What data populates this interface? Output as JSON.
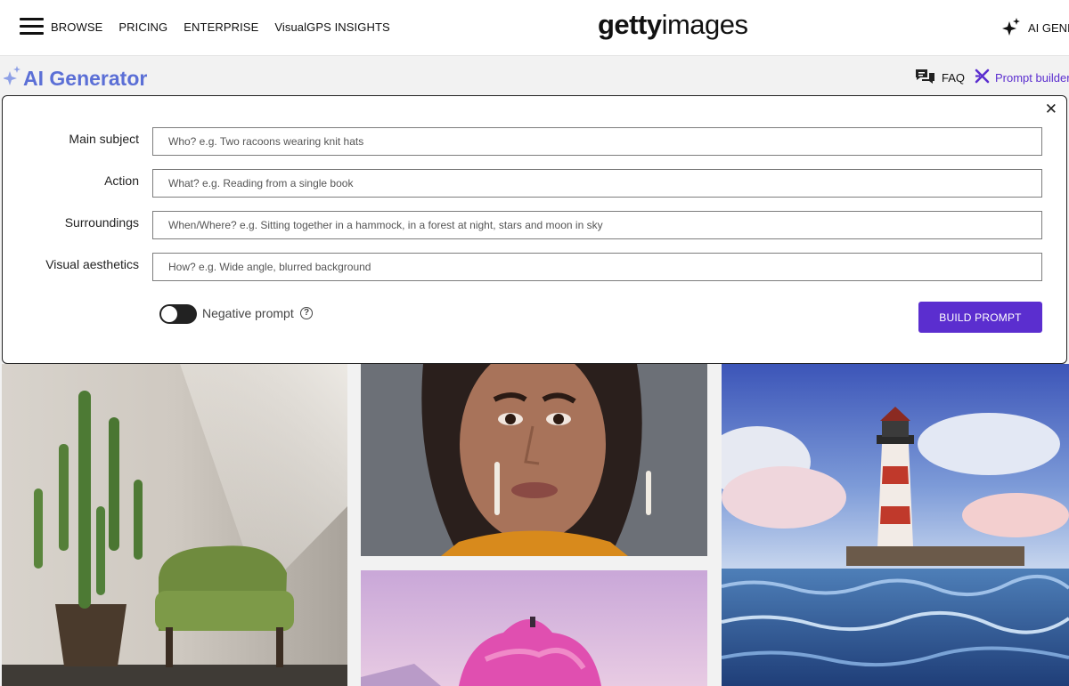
{
  "nav": {
    "items": [
      {
        "label": "BROWSE"
      },
      {
        "label": "PRICING"
      },
      {
        "label": "ENTERPRISE"
      },
      {
        "label": "VisualGPS INSIGHTS"
      }
    ]
  },
  "logo": {
    "bold": "getty",
    "light": "images"
  },
  "header_right": {
    "label": "AI GENE"
  },
  "generator": {
    "title": "AI Generator"
  },
  "links": {
    "faq": "FAQ",
    "prompt_builder": "Prompt builder"
  },
  "form": {
    "close_icon": "close-icon",
    "fields": [
      {
        "label": "Main subject",
        "placeholder": "Who? e.g. Two racoons wearing knit hats",
        "value": ""
      },
      {
        "label": "Action",
        "placeholder": "What? e.g. Reading from a single book",
        "value": ""
      },
      {
        "label": "Surroundings",
        "placeholder": "When/Where? e.g. Sitting together in a hammock, in a forest at night, stars and moon in sky",
        "value": ""
      },
      {
        "label": "Visual aesthetics",
        "placeholder": "How? e.g. Wide angle, blurred background",
        "value": ""
      }
    ],
    "negative_prompt": {
      "label": "Negative prompt",
      "enabled": true,
      "help": "?"
    },
    "build_button": "BUILD PROMPT"
  },
  "colors": {
    "accent": "#5b2ecf",
    "title": "#5b6fd6"
  }
}
